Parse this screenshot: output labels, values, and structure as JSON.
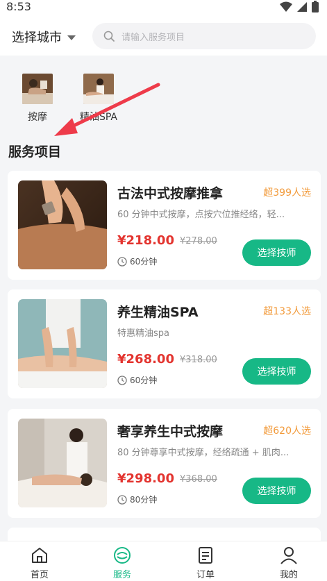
{
  "status": {
    "time": "8:53"
  },
  "header": {
    "city_label": "选择城市",
    "search_placeholder": "请输入服务项目"
  },
  "categories": [
    {
      "label": "按摩",
      "thumb_tone": "#7b5a3d"
    },
    {
      "label": "精油SPA",
      "thumb_tone": "#8f6a4b"
    }
  ],
  "section_title": "服务项目",
  "services": [
    {
      "title": "古法中式按摩推拿",
      "sold": "超399人选",
      "desc": "60 分钟中式按摩，点按穴位推经络，轻...",
      "price": "¥218.00",
      "orig": "¥278.00",
      "duration": "60分钟",
      "button": "选择技师"
    },
    {
      "title": "养生精油SPA",
      "sold": "超133人选",
      "desc": "特惠精油spa",
      "price": "¥268.00",
      "orig": "¥318.00",
      "duration": "60分钟",
      "button": "选择技师"
    },
    {
      "title": "奢享养生中式按摩",
      "sold": "超620人选",
      "desc": "80 分钟尊享中式按摩，经络疏通 + 肌肉...",
      "price": "¥298.00",
      "orig": "¥368.00",
      "duration": "80分钟",
      "button": "选择技师"
    }
  ],
  "tabbar": [
    {
      "label": "首页",
      "icon": "home-icon",
      "active": false
    },
    {
      "label": "服务",
      "icon": "service-icon",
      "active": true
    },
    {
      "label": "订单",
      "icon": "order-icon",
      "active": false
    },
    {
      "label": "我的",
      "icon": "user-icon",
      "active": false
    }
  ],
  "colors": {
    "accent": "#17b886",
    "price": "#e3342f",
    "sold": "#f29a3a",
    "annotation": "#ee3b4a"
  }
}
